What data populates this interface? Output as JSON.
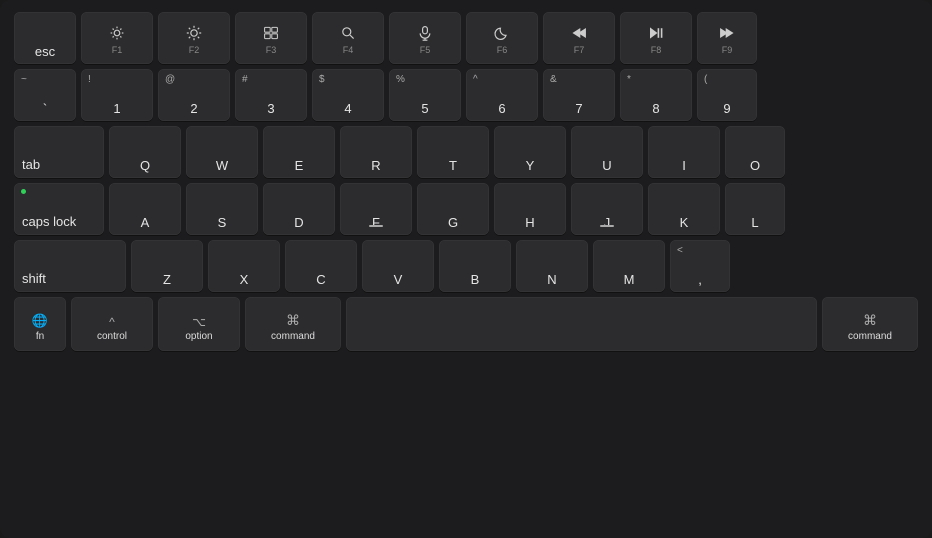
{
  "keyboard": {
    "rows": {
      "function_row": {
        "keys": [
          {
            "id": "esc",
            "label": "esc"
          },
          {
            "id": "f1",
            "icon": "brightness-low",
            "sublabel": "F1"
          },
          {
            "id": "f2",
            "icon": "brightness-high",
            "sublabel": "F2"
          },
          {
            "id": "f3",
            "icon": "mission-control",
            "sublabel": "F3"
          },
          {
            "id": "f4",
            "icon": "search",
            "sublabel": "F4"
          },
          {
            "id": "f5",
            "icon": "microphone",
            "sublabel": "F5"
          },
          {
            "id": "f6",
            "icon": "moon",
            "sublabel": "F6"
          },
          {
            "id": "f7",
            "icon": "rewind",
            "sublabel": "F7"
          },
          {
            "id": "f8",
            "icon": "play-pause",
            "sublabel": "F8"
          },
          {
            "id": "f9",
            "icon": "fast-forward",
            "sublabel": "F9"
          }
        ]
      },
      "number_row": {
        "keys": [
          {
            "id": "backtick",
            "top": "~",
            "bottom": "`"
          },
          {
            "id": "1",
            "top": "!",
            "bottom": "1"
          },
          {
            "id": "2",
            "top": "@",
            "bottom": "2"
          },
          {
            "id": "3",
            "top": "#",
            "bottom": "3"
          },
          {
            "id": "4",
            "top": "$",
            "bottom": "4"
          },
          {
            "id": "5",
            "top": "%",
            "bottom": "5"
          },
          {
            "id": "6",
            "top": "^",
            "bottom": "6"
          },
          {
            "id": "7",
            "top": "&",
            "bottom": "7"
          },
          {
            "id": "8",
            "top": "*",
            "bottom": "8"
          },
          {
            "id": "9",
            "top": "(",
            "bottom": "9"
          }
        ]
      },
      "qwerty_row": {
        "keys": [
          "Q",
          "W",
          "E",
          "R",
          "T",
          "Y",
          "U",
          "I",
          "O"
        ]
      },
      "asdf_row": {
        "keys": [
          "A",
          "S",
          "D",
          "F",
          "G",
          "H",
          "J",
          "K",
          "L"
        ]
      },
      "zxcv_row": {
        "keys": [
          "Z",
          "X",
          "C",
          "V",
          "B",
          "N",
          "M"
        ]
      },
      "bottom_row": {
        "fn_label": "fn",
        "globe_symbol": "⊕",
        "control_top": "^",
        "control_label": "control",
        "option_top": "⌥",
        "option_label": "option",
        "command_symbol": "⌘",
        "command_label": "command",
        "space_label": "",
        "command_right_symbol": "⌘",
        "command_right_label": "command"
      }
    }
  }
}
